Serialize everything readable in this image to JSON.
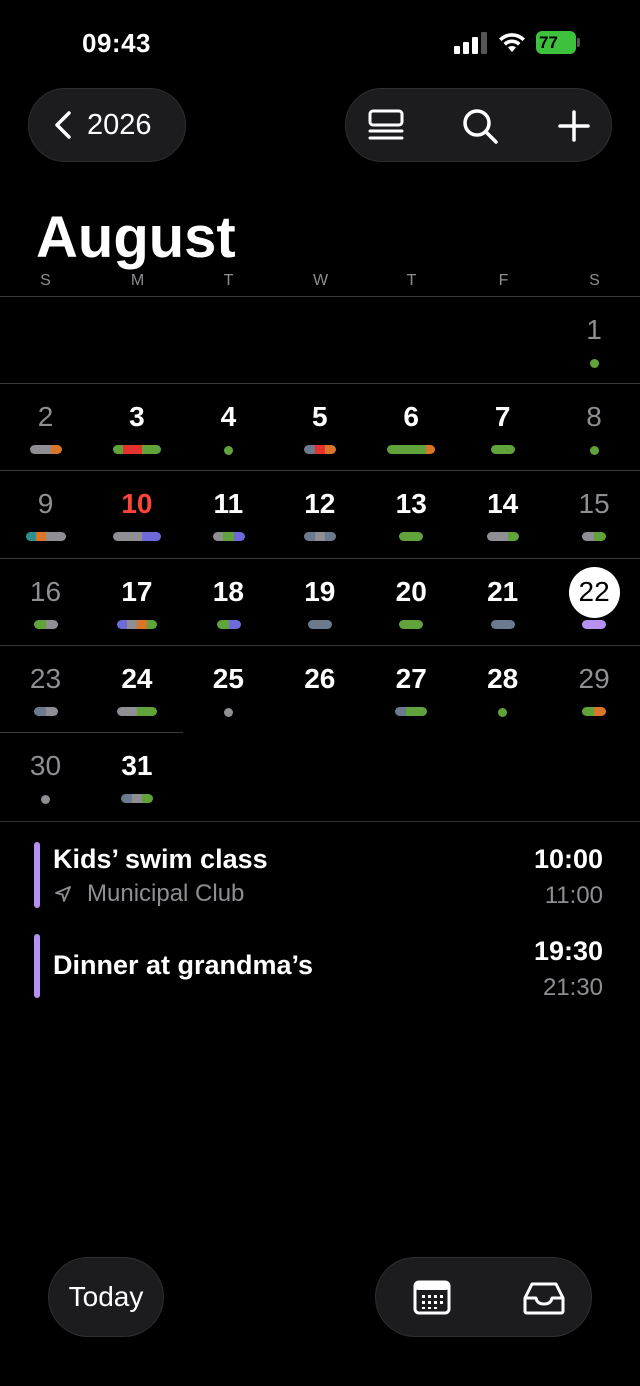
{
  "status_bar": {
    "time": "09:43",
    "battery": "77"
  },
  "header": {
    "year_label": "2026"
  },
  "month": {
    "title": "August"
  },
  "weekdays": [
    "S",
    "M",
    "T",
    "W",
    "T",
    "F",
    "S"
  ],
  "colors": {
    "gray": "#8e8e93",
    "orange": "#d9762a",
    "red": "#e5322d",
    "green": "#5fa33a",
    "teal": "#2e8f8f",
    "purple": "#6e6ad9",
    "slate": "#6b7a8f",
    "lavender": "#b592f2",
    "today_red": "#ff453a"
  },
  "days": [
    {
      "n": "1",
      "dot": "green"
    },
    {
      "n": "2",
      "bar": [
        "gray",
        "gray",
        "orange"
      ]
    },
    {
      "n": "3",
      "bar": [
        "green",
        "red",
        "red",
        "green",
        "green"
      ]
    },
    {
      "n": "4",
      "dot": "green"
    },
    {
      "n": "5",
      "bar": [
        "slate",
        "red",
        "orange"
      ]
    },
    {
      "n": "6",
      "bar": [
        "green",
        "green",
        "green",
        "green",
        "orange"
      ]
    },
    {
      "n": "7",
      "bar": [
        "green",
        "green"
      ]
    },
    {
      "n": "8",
      "dot": "green"
    },
    {
      "n": "9",
      "bar": [
        "teal",
        "orange",
        "gray",
        "gray"
      ]
    },
    {
      "n": "10",
      "bar": [
        "gray",
        "gray",
        "gray",
        "purple",
        "purple"
      ]
    },
    {
      "n": "11",
      "bar": [
        "gray",
        "green",
        "purple"
      ]
    },
    {
      "n": "12",
      "bar": [
        "slate",
        "gray",
        "slate"
      ]
    },
    {
      "n": "13",
      "bar": [
        "green",
        "green"
      ]
    },
    {
      "n": "14",
      "bar": [
        "gray",
        "gray",
        "green"
      ]
    },
    {
      "n": "15",
      "bar": [
        "gray",
        "green"
      ]
    },
    {
      "n": "16",
      "bar": [
        "green",
        "gray"
      ]
    },
    {
      "n": "17",
      "bar": [
        "purple",
        "gray",
        "orange",
        "green"
      ]
    },
    {
      "n": "18",
      "bar": [
        "green",
        "purple"
      ]
    },
    {
      "n": "19",
      "bar": [
        "slate",
        "slate"
      ]
    },
    {
      "n": "20",
      "bar": [
        "green",
        "green"
      ]
    },
    {
      "n": "21",
      "bar": [
        "slate",
        "slate"
      ]
    },
    {
      "n": "22",
      "bar": [
        "lavender",
        "lavender"
      ]
    },
    {
      "n": "23",
      "bar": [
        "slate",
        "gray"
      ]
    },
    {
      "n": "24",
      "bar": [
        "gray",
        "gray",
        "green",
        "green"
      ]
    },
    {
      "n": "25",
      "dot": "gray"
    },
    {
      "n": "26"
    },
    {
      "n": "27",
      "bar": [
        "slate",
        "green",
        "green"
      ]
    },
    {
      "n": "28",
      "dot": "green"
    },
    {
      "n": "29",
      "bar": [
        "green",
        "orange"
      ]
    },
    {
      "n": "30",
      "dot": "gray"
    },
    {
      "n": "31",
      "bar": [
        "slate",
        "gray",
        "green"
      ]
    }
  ],
  "events": [
    {
      "title": "Kids’ swim class",
      "location": "Municipal Club",
      "start": "10:00",
      "end": "11:00"
    },
    {
      "title": "Dinner at grandma’s",
      "location": "",
      "start": "19:30",
      "end": "21:30"
    }
  ],
  "bottom": {
    "today_label": "Today"
  }
}
